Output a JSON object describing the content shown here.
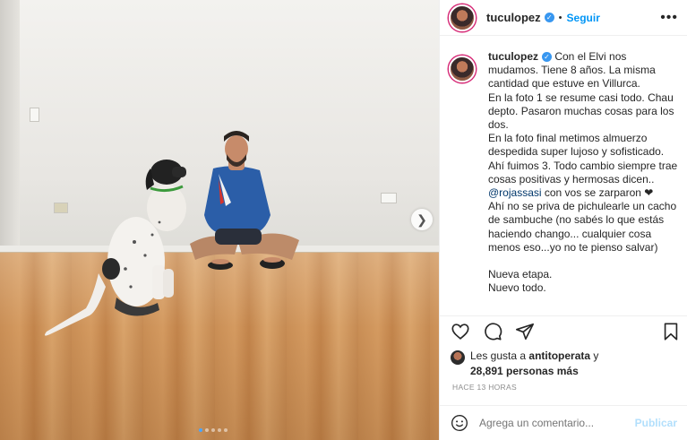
{
  "post": {
    "username": "tuculopez",
    "follow_label": "Seguir",
    "separator": "•",
    "more_label": "•••",
    "caption_lines": "Con el Elvi nos mudamos. Tiene 8 años. La misma cantidad que estuve en Villurca.\nEn la foto 1 se resume casi todo. Chau depto. Pasaron muchas cosas para los dos.\nEn la foto final metimos almuerzo despedida super lujoso y sofisticado. Ahí fuimos 3. Todo cambio siempre trae cosas positivas y hermosas dicen..",
    "mention": "@rojassasi",
    "mention_tail": " con vos se zarparon ❤",
    "caption_more": "Ahí no se priva de pichulearle un cacho de sambuche (no sabés lo que estás haciendo chango... cualquier cosa menos eso...yo no te pienso salvar)",
    "caption_end_1": "Nueva etapa.",
    "caption_end_2": "Nuevo todo.",
    "likes_prefix": "Les gusta a ",
    "likes_user": "antitoperata",
    "likes_suffix": " y",
    "likes_count": "28,891 personas más",
    "time": "HACE 13 HORAS",
    "comment_placeholder": "Agrega un comentario...",
    "publish_label": "Publicar"
  },
  "carousel": {
    "dots": 5,
    "active_index": 0
  },
  "colors": {
    "accent": "#0095f6",
    "verified": "#3897f0",
    "publish_disabled": "#b2dffc"
  }
}
